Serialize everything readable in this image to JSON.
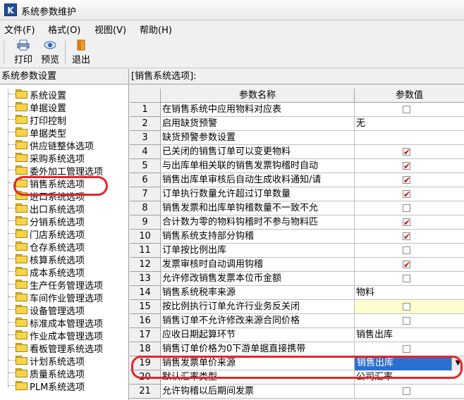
{
  "window": {
    "title": "系统参数维护"
  },
  "menu": [
    "文件(F)",
    "格式(O)",
    "视图(V)",
    "帮助(H)"
  ],
  "toolbar": {
    "print": "打印",
    "preview": "预览",
    "exit": "退出"
  },
  "left": {
    "header": "系统参数设置",
    "items": [
      "系统设置",
      "单据设置",
      "打印控制",
      "单据类型",
      "供应链整体选项",
      "采购系统选项",
      "委外加工管理选项",
      "销售系统选项",
      "进口系统选项",
      "出口系统选项",
      "分销系统选项",
      "门店系统选项",
      "仓存系统选项",
      "核算系统选项",
      "成本系统选项",
      "生产任务管理选项",
      "车间作业管理选项",
      "设备管理选项",
      "标准成本管理选项",
      "作业成本管理选项",
      "看板管理系统选项",
      "计划系统选项",
      "质量系统选项",
      "PLM系统选项"
    ]
  },
  "right": {
    "header": "[销售系统选项]:",
    "col_name": "参数名称",
    "col_value": "参数值",
    "rows": [
      {
        "n": "1",
        "name": "在销售系统中应用物料对应表",
        "type": "check",
        "checked": false
      },
      {
        "n": "2",
        "name": "启用缺货预警",
        "type": "text",
        "value": "无"
      },
      {
        "n": "3",
        "name": "缺货预警参数设置",
        "type": "text",
        "value": ""
      },
      {
        "n": "4",
        "name": "已关闭的销售订单可以变更物料",
        "type": "check",
        "checked": true
      },
      {
        "n": "5",
        "name": "与出库单相关联的销售发票钩稽时自动",
        "type": "check",
        "checked": true
      },
      {
        "n": "6",
        "name": "销售出库单审核后自动生成收料通知/请",
        "type": "check",
        "checked": true
      },
      {
        "n": "7",
        "name": "订单执行数量允许超过订单数量",
        "type": "check",
        "checked": true
      },
      {
        "n": "8",
        "name": "销售发票和出库单钩稽数量不一致不允",
        "type": "check",
        "checked": false
      },
      {
        "n": "9",
        "name": "合计数为零的物料钩稽时不参与物料匹",
        "type": "check",
        "checked": true
      },
      {
        "n": "10",
        "name": "销售系统支持部分钩稽",
        "type": "check",
        "checked": true
      },
      {
        "n": "11",
        "name": "订单按比例出库",
        "type": "check",
        "checked": false
      },
      {
        "n": "12",
        "name": "发票审核时自动调用钩稽",
        "type": "check",
        "checked": true
      },
      {
        "n": "13",
        "name": "允许修改销售发票本位币金额",
        "type": "check",
        "checked": false
      },
      {
        "n": "14",
        "name": "销售系统税率来源",
        "type": "text",
        "value": "物料"
      },
      {
        "n": "15",
        "name": "按比例执行订单允许行业务反关闭",
        "type": "check",
        "checked": false,
        "yellow": true
      },
      {
        "n": "16",
        "name": "销售订单不允许修改来源合同价格",
        "type": "check",
        "checked": false
      },
      {
        "n": "17",
        "name": "应收日期起算环节",
        "type": "text",
        "value": "销售出库"
      },
      {
        "n": "18",
        "name": "销售订单价格为0下游单据直接携带",
        "type": "check",
        "checked": false
      },
      {
        "n": "19",
        "name": "销售发票单价来源",
        "type": "combo",
        "value": "销售出库"
      },
      {
        "n": "20",
        "name": "默认汇率类型",
        "type": "text",
        "value": "公司汇率"
      },
      {
        "n": "21",
        "name": "允许钩稽以后期间发票",
        "type": "check",
        "checked": false
      }
    ]
  },
  "colors": {
    "highlight": "#e3262b",
    "selection": "#2b6fd1",
    "check": "#c80000"
  }
}
